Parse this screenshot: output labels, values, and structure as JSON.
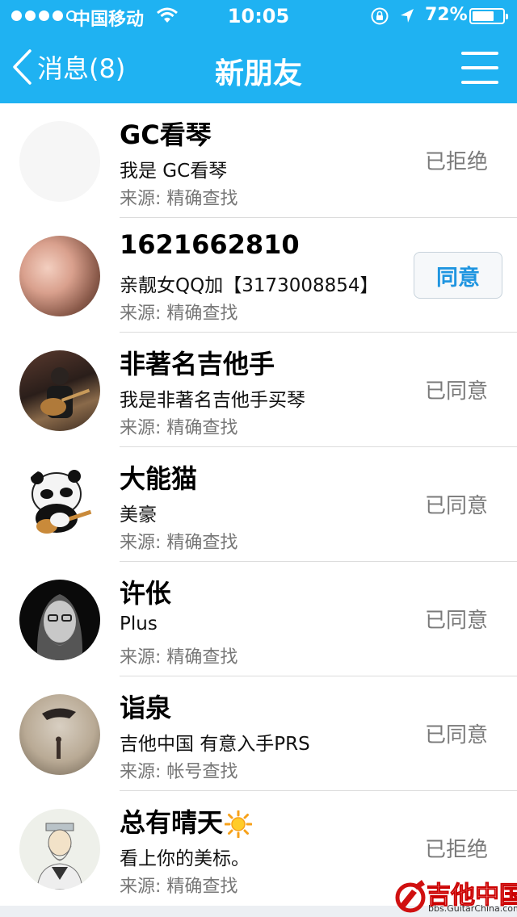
{
  "status_bar": {
    "carrier": "中国移动",
    "time": "10:05",
    "battery_percent": "72%",
    "battery_level": 0.72,
    "signal_bars": 4,
    "icons": [
      "wifi-icon",
      "rotation-lock-icon",
      "location-arrow-icon",
      "battery-icon"
    ]
  },
  "nav": {
    "back_label": "消息(8)",
    "title": "新朋友",
    "menu_icon": "menu-icon"
  },
  "requests": [
    {
      "name": "GC看琴",
      "message": "我是  GC看琴",
      "source": "来源:  精确查找",
      "status": "已拒绝"
    },
    {
      "name": "1621662810",
      "message": "亲靓女QQ加【3173008854】",
      "source": "来源:  精确查找",
      "action_label": "同意"
    },
    {
      "name": "非著名吉他手",
      "message": "我是非著名吉他手买琴",
      "source": "来源:  精确查找",
      "status": "已同意"
    },
    {
      "name": "大能猫",
      "message": "美豪",
      "source": "来源:  精确查找",
      "status": "已同意"
    },
    {
      "name": " 许伥",
      "message": "Plus",
      "source": "来源:  精确查找",
      "status": "已同意"
    },
    {
      "name": "诣泉",
      "message": "吉他中国 有意入手PRS",
      "source": "来源:  帐号查找",
      "status": "已同意"
    },
    {
      "name": "总有晴天",
      "message": "看上你的美标。",
      "source": "来源:  精确查找",
      "status": "已拒绝"
    }
  ],
  "watermark": {
    "text": "吉他中国",
    "url": "bbs.GuitarChina.com"
  },
  "colors": {
    "header_bg": "#1fb2f2",
    "accent": "#1f95e0",
    "status_gray": "#7a7a7a"
  }
}
